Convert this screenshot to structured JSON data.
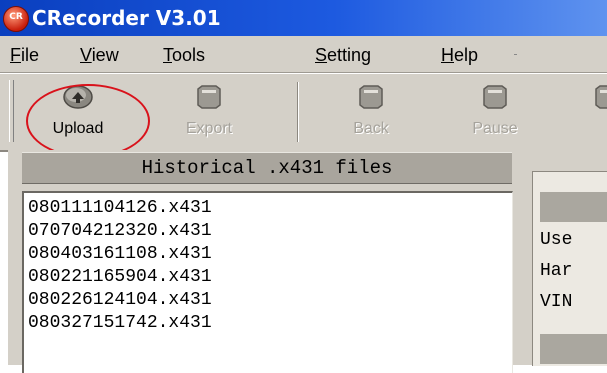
{
  "window": {
    "title": "CRecorder V3.01",
    "icon_text": "CR",
    "icon_name": "crecorder-app-icon"
  },
  "menu": [
    {
      "label": "File",
      "accel": "F",
      "rest": "ile"
    },
    {
      "label": "View",
      "accel": "V",
      "rest": "iew"
    },
    {
      "label": "Tools",
      "accel": "T",
      "rest": "ools"
    },
    {
      "label": "Setting",
      "accel": "S",
      "rest": "etting"
    },
    {
      "label": "Help",
      "accel": "H",
      "rest": "elp"
    }
  ],
  "toolbar": {
    "upload": {
      "label": "Upload",
      "icon": "upload-disc-icon",
      "enabled": true,
      "highlighted": true
    },
    "export": {
      "label": "Export",
      "icon": "export-disc-icon",
      "enabled": false
    },
    "back": {
      "label": "Back",
      "icon": "back-disc-icon",
      "enabled": false
    },
    "pause": {
      "label": "Pause",
      "icon": "pause-disc-icon",
      "enabled": false
    }
  },
  "files_panel": {
    "header": "Historical .x431 files",
    "files": [
      "080111104126.x431",
      "070704212320.x431",
      "080403161108.x431",
      "080221165904.x431",
      "080226124104.x431",
      "080327151742.x431"
    ]
  },
  "info_panel": {
    "labels": [
      "Use",
      "Har",
      "VIN"
    ]
  },
  "colors": {
    "title_bar": "#1d5ae0",
    "chrome": "#d4d0c8",
    "highlight_circle": "#d9121b"
  }
}
